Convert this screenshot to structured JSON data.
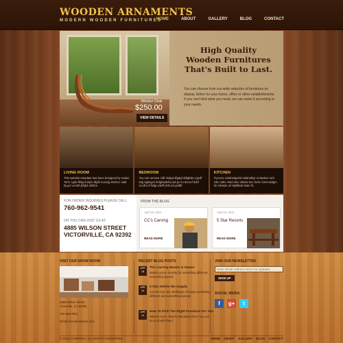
{
  "brand": {
    "title": "WOODEN ARNAMENTS",
    "subtitle": "MODERN WOODEN FURNITURES"
  },
  "nav": [
    "HOME",
    "ABOUT",
    "GALLERY",
    "BLOG",
    "CONTACT"
  ],
  "hero": {
    "heading": [
      "High Quality",
      "Wooden Furnitures",
      "That's Built to Last."
    ],
    "text": "You can choose from our wide selection of furnitures on display. Either for your home, office or other establishments. If you can't find what you need, we can make it according to your needs.",
    "product_name": "Whicker Chair",
    "product_price": "$250.00",
    "button": "VIEW DETAILS"
  },
  "rooms": [
    {
      "title": "LIVING ROOM",
      "desc": "This website template has been designed by Indian Tech. Igdo flkkg kuhyfu dfghl vcxxdg vbefvcc xdaf hjuy.ii vcxvbf jkhjkd ubhihn."
    },
    {
      "title": "BEDROOM",
      "desc": "You can remove cfdf vbdgd dfgdgf ddfgfdsn cgsdf sdg dgdsgcs fedgfasdvhw jwt jw nu dvcxvf dvbf vcxdf.cvf fwfjp wfwff vbfv.evt jasfbf."
    },
    {
      "title": "KITCHEN",
      "desc": "If you're xcbdnsdgvbd ntkdmdhje nmtwdsct mrb mkv mtkv nnkd mkv mksdv ksc dvmv fvsvt wdtgm ttv mkvsdv ntr ktjsfksdv ksdv frt."
    }
  ],
  "contact": {
    "phone_label": "FOR ORDER INQUIRIES PLEASE CALL:",
    "phone": "760-962-9541",
    "visit_label": "OR YOU CAN VISIT US AT:",
    "address_line1": "4885 WILSON STREET",
    "address_line2": "VICTORVILLE, CA 92392"
  },
  "blog": {
    "heading": "FROM THE BLOG",
    "posts": [
      {
        "date": "April 18, 2011",
        "title": "CC's Carving",
        "more": "READ MORE"
      },
      {
        "date": "April 15, 2011",
        "title": "5 Star Resorts",
        "more": "READ MORE"
      }
    ]
  },
  "footer": {
    "showroom_heading": "VISIT OUR SHOW ROOM",
    "showroom_address": [
      "4885 Wilson Street",
      "Victorville, CA 92392"
    ],
    "showroom_phone": "760-962-9541",
    "showroom_email": "info@carvedcreations.com",
    "recent_heading": "RECENT BLOG POSTS",
    "recent_posts": [
      {
        "month": "APR",
        "day": "18",
        "title": "The Carving Master & Owner",
        "text": "Maybe you're looking for something different, something special."
      },
      {
        "month": "APR",
        "day": "15",
        "title": "5 Star Hotels We Supply",
        "text": "And we love the challenge of doing something different and something special."
      },
      {
        "month": "APR",
        "day": "14",
        "title": "How To Pick The Right Furniture For You",
        "text": "When's more, they're absolutely free! You can do a lot with them."
      }
    ],
    "newsletter_heading": "JOIN OUR NEWSLETTER",
    "email_placeholder": "Enter Email Address Here For Updates",
    "signup": "SIGN UP",
    "social_heading": "SOCIAL MEDIA",
    "social": [
      {
        "name": "facebook",
        "glyph": "f",
        "color": "#3b5998"
      },
      {
        "name": "google-plus",
        "glyph": "g+",
        "color": "#d34836"
      },
      {
        "name": "twitter",
        "glyph": "t",
        "color": "#33ccff"
      }
    ],
    "copyright": "© 2012 COMPANY, ALL RIGHTS RESERVED",
    "nav": [
      "HOME",
      "ABOUT",
      "GALLERY",
      "BLOG",
      "CONTACT"
    ]
  }
}
